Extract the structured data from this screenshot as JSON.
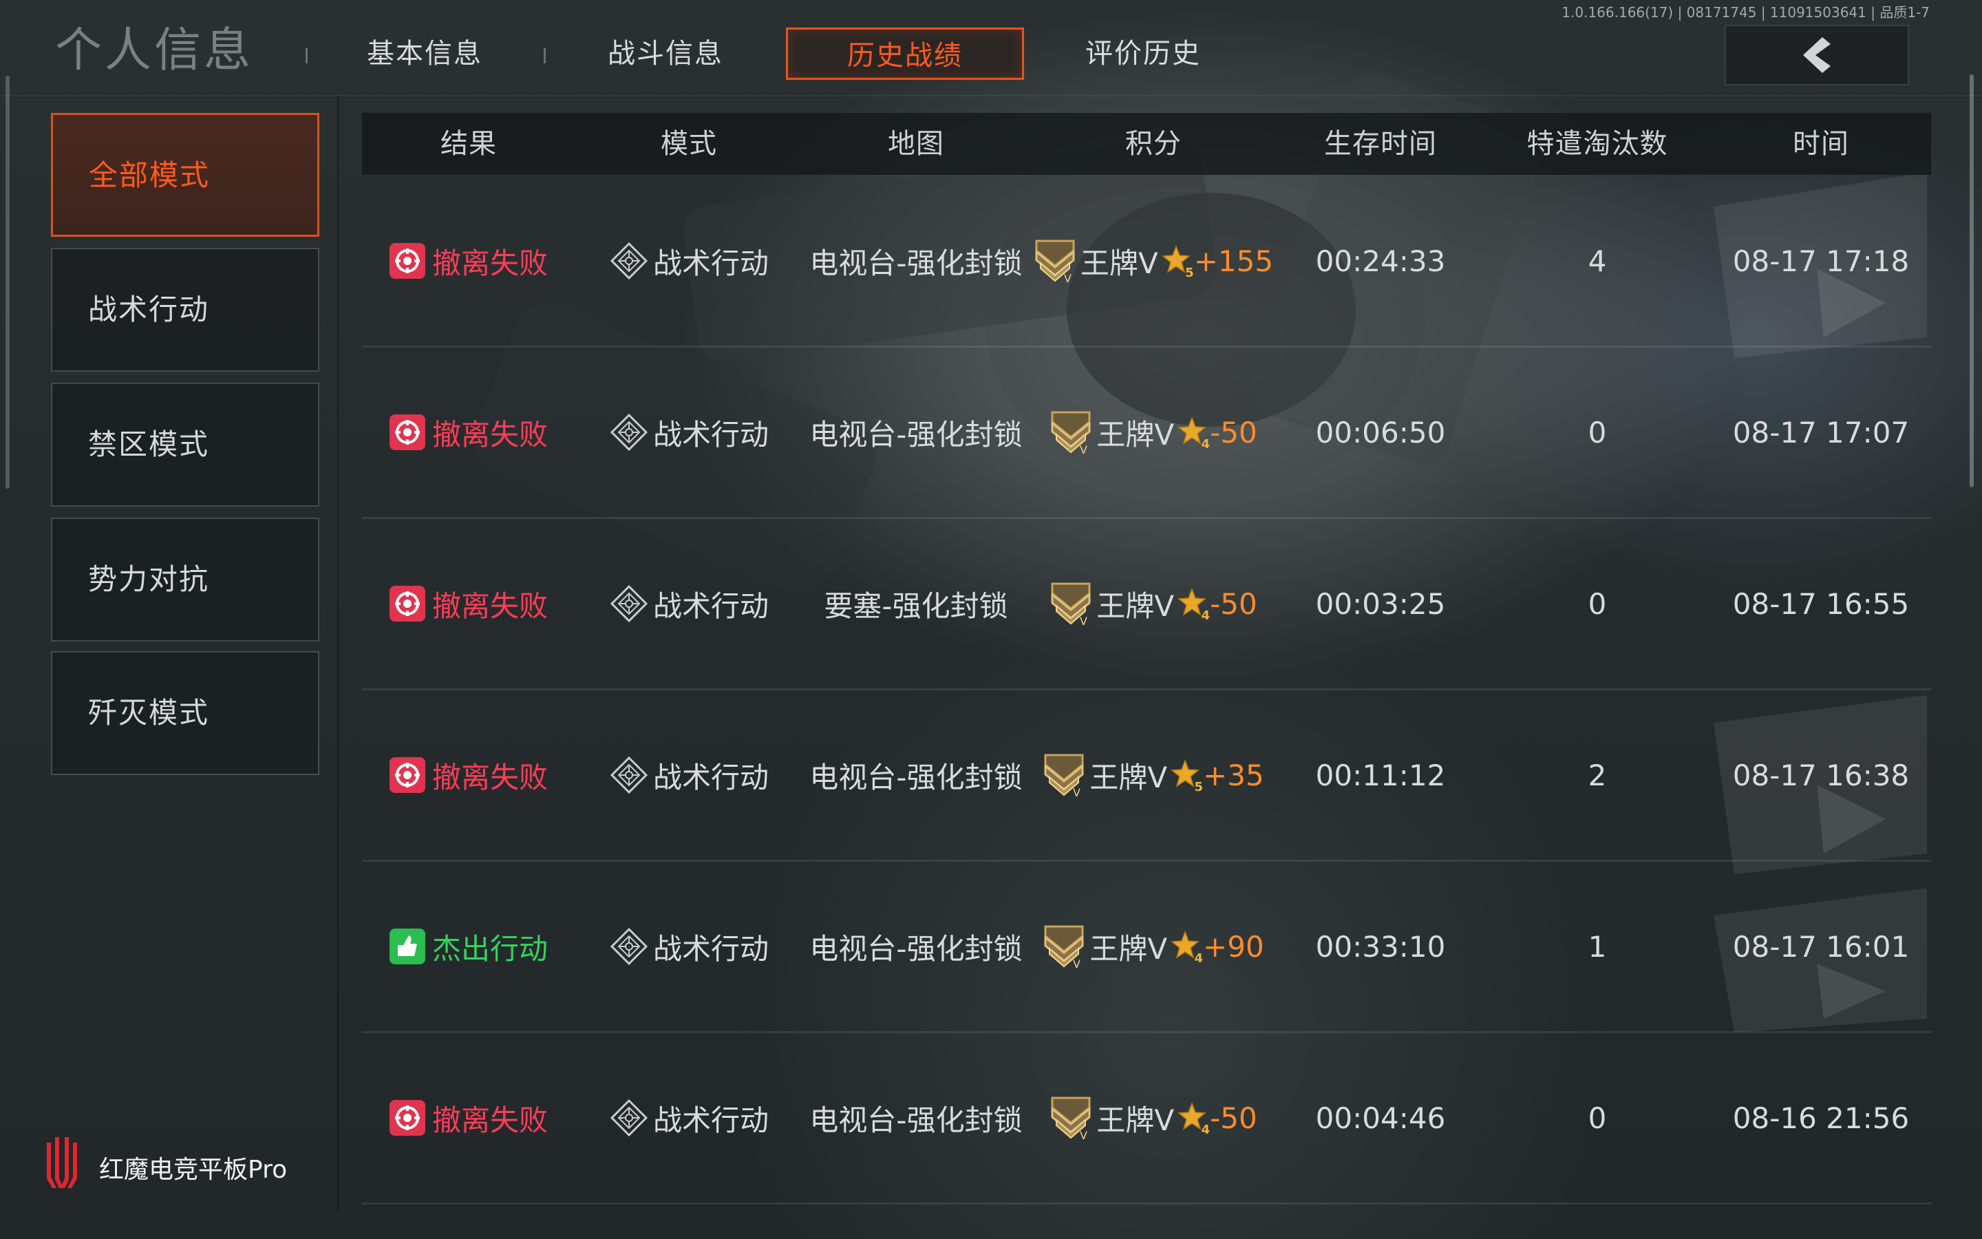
{
  "page_title": "个人信息",
  "version_text": "1.0.166.166(17) | 08171745 | 11091503641 | 品质1-7",
  "tabs": [
    {
      "label": "基本信息",
      "active": false
    },
    {
      "label": "战斗信息",
      "active": false
    },
    {
      "label": "历史战绩",
      "active": true
    },
    {
      "label": "评价历史",
      "active": false
    }
  ],
  "back_icon": "chevron-left-icon",
  "sidebar": {
    "items": [
      {
        "label": "全部模式",
        "active": true
      },
      {
        "label": "战术行动",
        "active": false
      },
      {
        "label": "禁区模式",
        "active": false
      },
      {
        "label": "势力对抗",
        "active": false
      },
      {
        "label": "歼灭模式",
        "active": false
      }
    ]
  },
  "table": {
    "columns": [
      "结果",
      "模式",
      "地图",
      "积分",
      "生存时间",
      "特遣淘汰数",
      "时间"
    ],
    "rows": [
      {
        "result": "撤离失败",
        "result_type": "fail",
        "mode": "战术行动",
        "map": "电视台-强化封锁",
        "rank": "王牌V",
        "star_level": "5",
        "score_delta": "+155",
        "survival_time": "00:24:33",
        "eliminations": "4",
        "time": "08-17 17:18"
      },
      {
        "result": "撤离失败",
        "result_type": "fail",
        "mode": "战术行动",
        "map": "电视台-强化封锁",
        "rank": "王牌V",
        "star_level": "4",
        "score_delta": "-50",
        "survival_time": "00:06:50",
        "eliminations": "0",
        "time": "08-17 17:07"
      },
      {
        "result": "撤离失败",
        "result_type": "fail",
        "mode": "战术行动",
        "map": "要塞-强化封锁",
        "rank": "王牌V",
        "star_level": "4",
        "score_delta": "-50",
        "survival_time": "00:03:25",
        "eliminations": "0",
        "time": "08-17 16:55"
      },
      {
        "result": "撤离失败",
        "result_type": "fail",
        "mode": "战术行动",
        "map": "电视台-强化封锁",
        "rank": "王牌V",
        "star_level": "5",
        "score_delta": "+35",
        "survival_time": "00:11:12",
        "eliminations": "2",
        "time": "08-17 16:38"
      },
      {
        "result": "杰出行动",
        "result_type": "success",
        "mode": "战术行动",
        "map": "电视台-强化封锁",
        "rank": "王牌V",
        "star_level": "4",
        "score_delta": "+90",
        "survival_time": "00:33:10",
        "eliminations": "1",
        "time": "08-17 16:01"
      },
      {
        "result": "撤离失败",
        "result_type": "fail",
        "mode": "战术行动",
        "map": "电视台-强化封锁",
        "rank": "王牌V",
        "star_level": "4",
        "score_delta": "-50",
        "survival_time": "00:04:46",
        "eliminations": "0",
        "time": "08-16 21:56"
      }
    ]
  },
  "brand": {
    "text": "红魔电竞平板Pro",
    "logo_icon": "red-magic-logo-icon"
  },
  "colors": {
    "accent": "#ff5a1e",
    "fail": "#ff3c56",
    "success": "#34d45c",
    "delta": "#ff8c2a",
    "star": "#f2b43a"
  }
}
